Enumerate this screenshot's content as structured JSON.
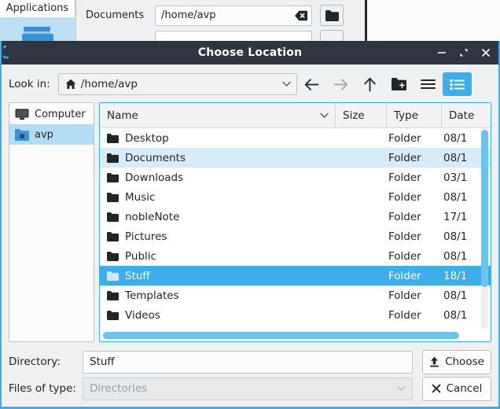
{
  "background_app": {
    "tab_label": "Applications",
    "folder_icon": "folder-icon",
    "form_rows": [
      {
        "label": "Documents",
        "value": "/home/avp",
        "clear_icon": "clear-text-icon",
        "browse_icon": "folder-browse-icon"
      },
      {
        "label": "",
        "value": "",
        "clear_icon": "clear-text-icon",
        "browse_icon": "folder-browse-icon"
      }
    ]
  },
  "dialog": {
    "title": "Choose Location",
    "app_icon": "application-icon",
    "window_controls": [
      {
        "name": "minimize-button",
        "glyph": "−"
      },
      {
        "name": "maximize-button",
        "glyph": "⤡"
      },
      {
        "name": "close-button",
        "glyph": "✕"
      }
    ],
    "toolbar": {
      "lookin_label": "Look in:",
      "lookin_value": "/home/avp",
      "lookin_icon": "home-icon",
      "buttons": [
        {
          "name": "back-button",
          "icon": "arrow-left-icon",
          "enabled": true,
          "active": false
        },
        {
          "name": "forward-button",
          "icon": "arrow-right-icon",
          "enabled": false,
          "active": false
        },
        {
          "name": "parent-directory-button",
          "icon": "arrow-up-icon",
          "enabled": true,
          "active": false
        },
        {
          "name": "new-folder-button",
          "icon": "new-folder-icon",
          "enabled": true,
          "active": false
        },
        {
          "name": "list-view-button",
          "icon": "list-view-icon",
          "enabled": true,
          "active": false
        },
        {
          "name": "detail-view-button",
          "icon": "detail-view-icon",
          "enabled": true,
          "active": true
        }
      ]
    },
    "sidebar": {
      "items": [
        {
          "label": "Computer",
          "icon": "computer-icon",
          "selected": false
        },
        {
          "label": "avp",
          "icon": "home-folder-icon",
          "selected": true
        }
      ]
    },
    "file_list": {
      "columns": [
        {
          "label": "Name",
          "sort_icon": "chevron-down-icon"
        },
        {
          "label": "Size",
          "sort_icon": ""
        },
        {
          "label": "Type",
          "sort_icon": ""
        },
        {
          "label": "Date",
          "sort_icon": ""
        }
      ],
      "rows": [
        {
          "name": "Desktop",
          "size": "",
          "type": "Folder",
          "date": "08/1",
          "state": "normal",
          "icon": "folder-icon"
        },
        {
          "name": "Documents",
          "size": "",
          "type": "Folder",
          "date": "08/1",
          "state": "hover",
          "icon": "folder-icon"
        },
        {
          "name": "Downloads",
          "size": "",
          "type": "Folder",
          "date": "03/1",
          "state": "normal",
          "icon": "folder-icon"
        },
        {
          "name": "Music",
          "size": "",
          "type": "Folder",
          "date": "08/1",
          "state": "normal",
          "icon": "folder-icon"
        },
        {
          "name": "nobleNote",
          "size": "",
          "type": "Folder",
          "date": "17/1",
          "state": "normal",
          "icon": "folder-icon"
        },
        {
          "name": "Pictures",
          "size": "",
          "type": "Folder",
          "date": "08/1",
          "state": "normal",
          "icon": "folder-icon"
        },
        {
          "name": "Public",
          "size": "",
          "type": "Folder",
          "date": "08/1",
          "state": "normal",
          "icon": "folder-icon"
        },
        {
          "name": "Stuff",
          "size": "",
          "type": "Folder",
          "date": "18/1",
          "state": "selected",
          "icon": "folder-icon"
        },
        {
          "name": "Templates",
          "size": "",
          "type": "Folder",
          "date": "08/1",
          "state": "normal",
          "icon": "folder-icon"
        },
        {
          "name": "Videos",
          "size": "",
          "type": "Folder",
          "date": "08/1",
          "state": "normal",
          "icon": "folder-icon"
        }
      ],
      "vertical_scrollbar": "vertical-scrollbar",
      "horizontal_scrollbar": "horizontal-scrollbar"
    },
    "bottom_form": {
      "directory_label": "Directory:",
      "directory_value": "Stuff",
      "filetype_label": "Files of type:",
      "filetype_value": "Directories",
      "filetype_disabled": true,
      "choose_button": {
        "label": "Choose",
        "icon": "upload-arrow-icon"
      },
      "cancel_button": {
        "label": "Cancel",
        "icon": "close-x-icon"
      }
    }
  },
  "colors": {
    "accent": "#3daee9",
    "titlebar": "#2f3541",
    "window_bg": "#eff0f1",
    "hover_row": "#d7ecfa",
    "sidebar_selected": "#b3ddf5"
  }
}
